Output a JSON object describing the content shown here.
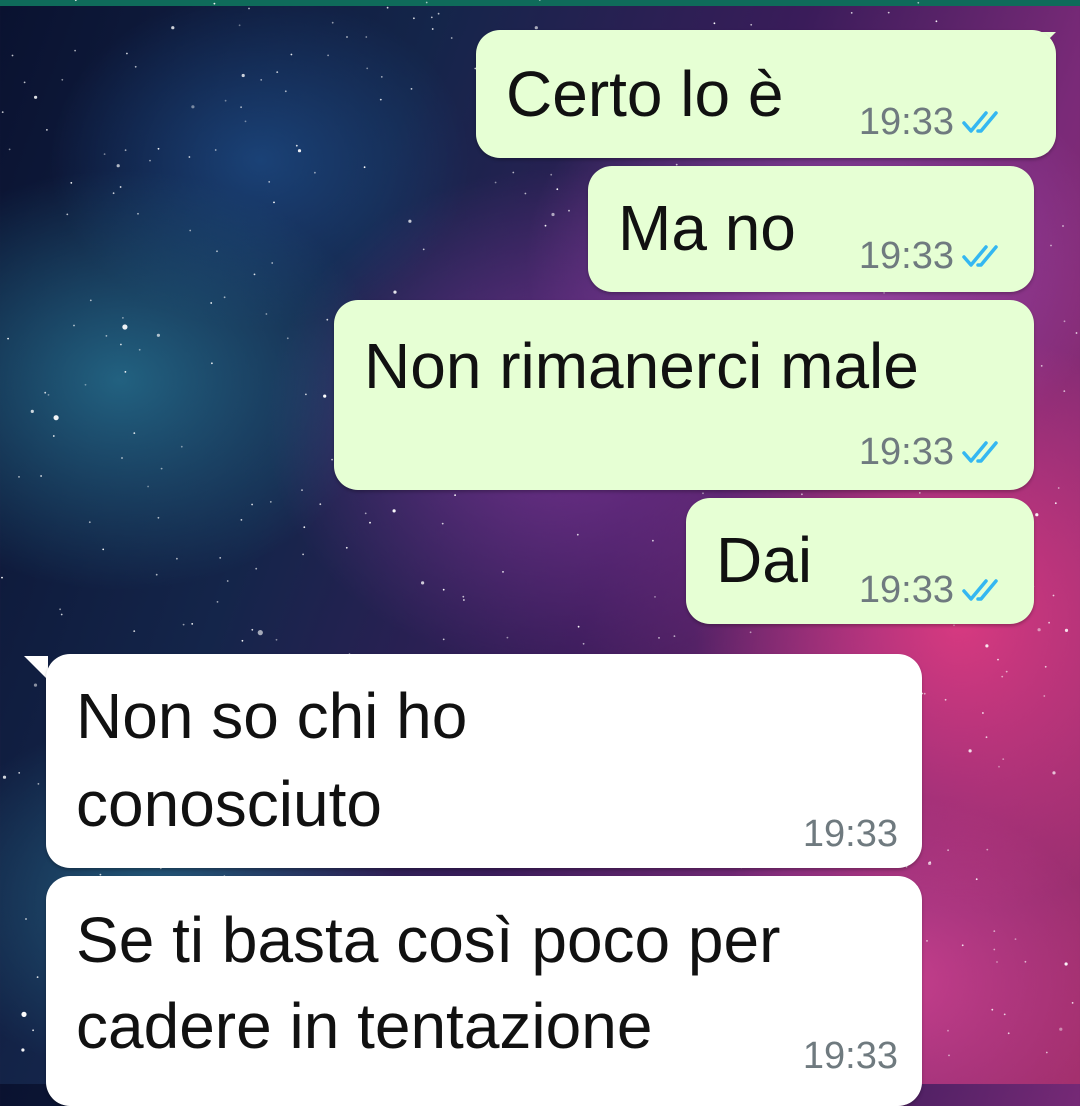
{
  "theme": {
    "outgoing_bubble": "#e6ffd4",
    "incoming_bubble": "#ffffff",
    "read_tick": "#34b7f1",
    "timestamp": "#6f7a7f"
  },
  "messages": [
    {
      "direction": "outgoing",
      "lines": [
        "Certo lo è"
      ],
      "time": "19:33",
      "status_icon": "double-check-icon"
    },
    {
      "direction": "outgoing",
      "lines": [
        "Ma no"
      ],
      "time": "19:33",
      "status_icon": "double-check-icon"
    },
    {
      "direction": "outgoing",
      "lines": [
        "Non rimanerci male"
      ],
      "time": "19:33",
      "status_icon": "double-check-icon"
    },
    {
      "direction": "outgoing",
      "lines": [
        "Dai"
      ],
      "time": "19:33",
      "status_icon": "double-check-icon"
    },
    {
      "direction": "incoming",
      "lines": [
        "Non so chi ho",
        "conosciuto"
      ],
      "time": "19:33"
    },
    {
      "direction": "incoming",
      "lines": [
        "Se ti basta così poco per",
        "cadere in tentazione"
      ],
      "time": "19:33"
    }
  ]
}
